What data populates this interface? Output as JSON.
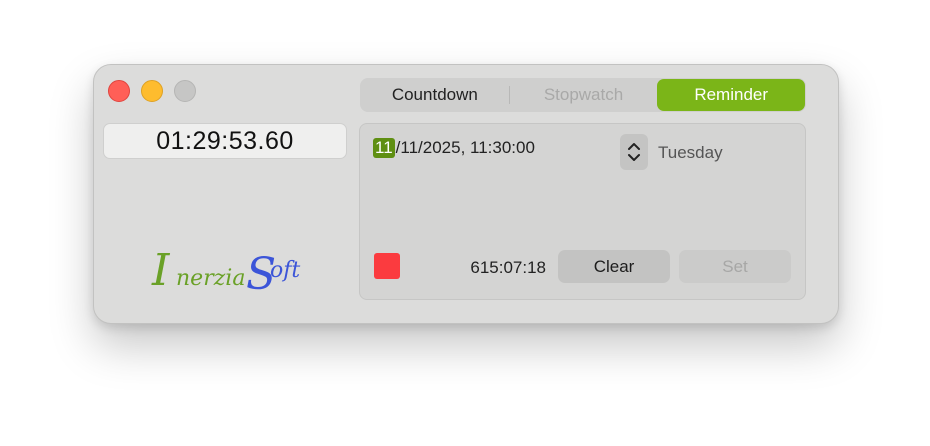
{
  "clock": {
    "time": "01:29:53.60"
  },
  "logo": {
    "text": "InerziaSoft",
    "first_color": "#6aa127",
    "second_color": "#3c55d8"
  },
  "tabs": [
    {
      "label": "Countdown",
      "state": "normal"
    },
    {
      "label": "Stopwatch",
      "state": "disabled"
    },
    {
      "label": "Reminder",
      "state": "selected"
    }
  ],
  "reminder": {
    "date_day": "11",
    "date_rest": "/11/2025, 11:30:00",
    "weekday": "Tuesday",
    "remaining": "615:07:18",
    "clear_label": "Clear",
    "set_label": "Set"
  },
  "colors": {
    "accent": "#7bb518",
    "status_square": "#fb3b3f",
    "day_highlight": "#5f8f12"
  }
}
